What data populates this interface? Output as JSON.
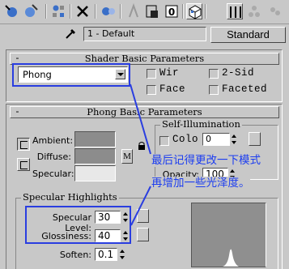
{
  "material": {
    "name": "1 - Default",
    "type_button": "Standard"
  },
  "shader_basic": {
    "title": "Shader Basic Parameters",
    "collapse_glyph": "-",
    "shader": "Phong",
    "wire_label": "Wir",
    "two_sided_label": "2-Sid",
    "face_label": "Face",
    "faceted_label": "Faceted"
  },
  "phong_basic": {
    "title": "Phong Basic Parameters",
    "collapse_glyph": "-",
    "ambient_label": "Ambient:",
    "diffuse_label": "Diffuse:",
    "specular_label": "Specular:",
    "map_button": "M",
    "self_illum_title": "Self-Illumination",
    "color_label": "Colo",
    "self_illum_value": "0",
    "opacity_label": "Opacity:",
    "opacity_value": "100",
    "colors": {
      "ambient": "#8c8c8c",
      "diffuse": "#8c8c8c",
      "specular": "#e8e8e8"
    }
  },
  "specular_highlights": {
    "title": "Specular Highlights",
    "level_label": "Specular Level:",
    "level_value": "30",
    "glossiness_label": "Glossiness:",
    "glossiness_value": "40",
    "soften_label": "Soften:",
    "soften_value": "0.1"
  },
  "annotation": {
    "line1": "最后记得更改一下模式",
    "line2": "再增加一些光泽度。",
    "color": "#1d3ef0"
  }
}
